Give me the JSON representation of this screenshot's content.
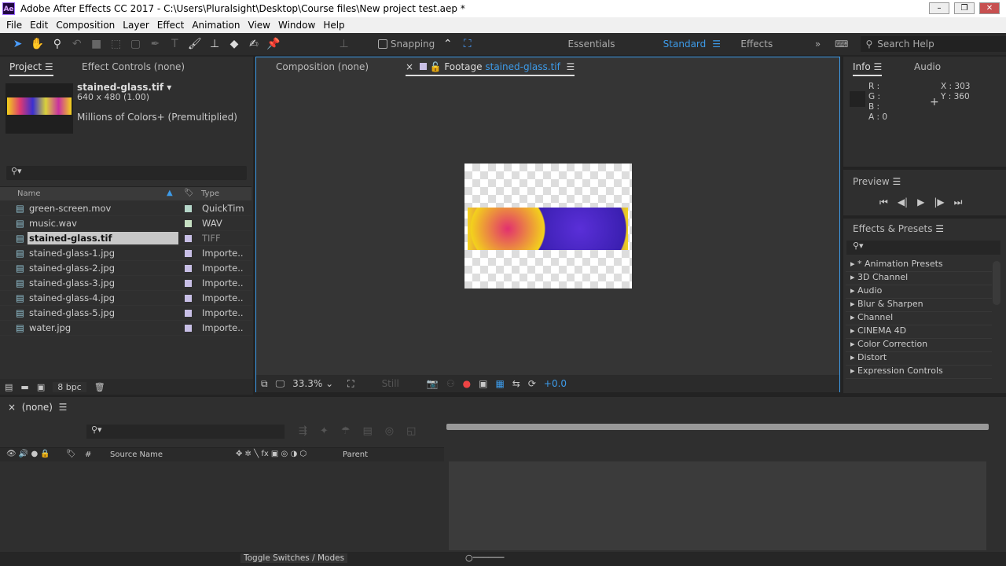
{
  "window": {
    "title": "Adobe After Effects CC 2017 - C:\\Users\\Pluralsight\\Desktop\\Course files\\New project test.aep *",
    "logo": "Ae"
  },
  "menu": [
    "File",
    "Edit",
    "Composition",
    "Layer",
    "Effect",
    "Animation",
    "View",
    "Window",
    "Help"
  ],
  "toolbar": {
    "snapping": "Snapping",
    "workspaces": [
      "Essentials",
      "Standard",
      "Effects"
    ],
    "active_workspace": "Standard",
    "search_placeholder": "Search Help"
  },
  "project": {
    "tab": "Project",
    "tab2": "Effect Controls (none)",
    "selected_name": "stained-glass.tif",
    "dims": "640 x 480 (1.00)",
    "colors": "Millions of Colors+ (Premultiplied)",
    "columns": {
      "name": "Name",
      "type": "Type"
    },
    "items": [
      {
        "name": "green-screen.mov",
        "type": "QuickTim",
        "color": "#b5d6c9",
        "icon": "movie-file-icon"
      },
      {
        "name": "music.wav",
        "type": "WAV",
        "color": "#c7e0c3",
        "icon": "audio-file-icon"
      },
      {
        "name": "stained-glass.tif",
        "type": "TIFF",
        "color": "#c8bfe6",
        "icon": "image-file-icon",
        "selected": true
      },
      {
        "name": "stained-glass-1.jpg",
        "type": "Importe..",
        "color": "#c8bfe6",
        "icon": "image-file-icon"
      },
      {
        "name": "stained-glass-2.jpg",
        "type": "Importe..",
        "color": "#c8bfe6",
        "icon": "image-file-icon"
      },
      {
        "name": "stained-glass-3.jpg",
        "type": "Importe..",
        "color": "#c8bfe6",
        "icon": "image-file-icon"
      },
      {
        "name": "stained-glass-4.jpg",
        "type": "Importe..",
        "color": "#c8bfe6",
        "icon": "image-file-icon"
      },
      {
        "name": "stained-glass-5.jpg",
        "type": "Importe..",
        "color": "#c8bfe6",
        "icon": "image-file-icon"
      },
      {
        "name": "water.jpg",
        "type": "Importe..",
        "color": "#c8bfe6",
        "icon": "image-file-icon"
      }
    ],
    "bpc": "8 bpc"
  },
  "viewer": {
    "tab_comp": "Composition (none)",
    "tab_footage_prefix": "Footage",
    "tab_footage_name": "stained-glass.tif",
    "zoom": "33.3%",
    "still": "Still",
    "exposure": "+0.0"
  },
  "info": {
    "tab": "Info",
    "tab2": "Audio",
    "r": "R :",
    "g": "G :",
    "b": "B :",
    "a": "A : 0",
    "x": "X : 303",
    "y": "Y : 360"
  },
  "preview": {
    "title": "Preview"
  },
  "effects": {
    "title": "Effects & Presets",
    "items": [
      "* Animation Presets",
      "3D Channel",
      "Audio",
      "Blur & Sharpen",
      "Channel",
      "CINEMA 4D",
      "Color Correction",
      "Distort",
      "Expression Controls"
    ]
  },
  "timeline": {
    "tab": "(none)",
    "source_name": "Source Name",
    "parent": "Parent",
    "hash": "#",
    "toggle": "Toggle Switches / Modes"
  },
  "accent": "#3d9be9"
}
